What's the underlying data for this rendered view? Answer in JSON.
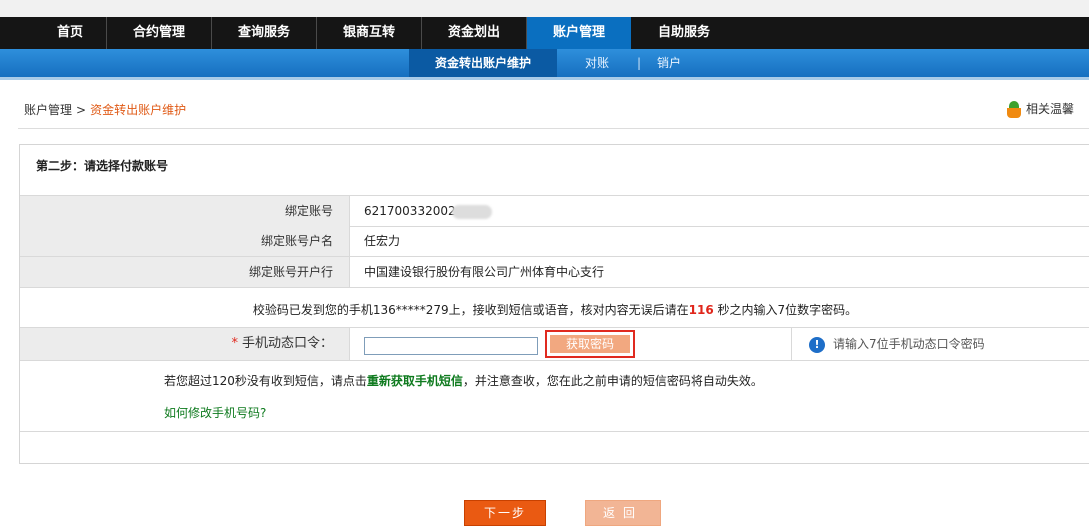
{
  "nav": {
    "items": [
      "首页",
      "合约管理",
      "查询服务",
      "银商互转",
      "资金划出",
      "账户管理",
      "自助服务"
    ],
    "active": "账户管理"
  },
  "subnav": {
    "items": [
      "资金转出账户维护",
      "对账",
      "销户"
    ],
    "separator": "|"
  },
  "breadcrumb": {
    "root": "账户管理",
    "arrow": ">",
    "current": "资金转出账户维护"
  },
  "tips_label": "相关温馨",
  "step": {
    "title": "第二步：请选择付款账号",
    "fields": [
      {
        "label": "绑定账号",
        "value": "621700332002"
      },
      {
        "label": "绑定账号户名",
        "value": "任宏力"
      },
      {
        "label": "绑定账号开户行",
        "value": "中国建设银行股份有限公司广州体育中心支行"
      }
    ]
  },
  "notice": {
    "before": "校验码已发到您的手机136*****279上，接收到短信或语音，核对内容无误后请在",
    "seconds": "116",
    "after": " 秒之内输入7位数字密码。"
  },
  "otp": {
    "required_mark": "*",
    "label": "手机动态口令：",
    "value": "",
    "get_button": "获取密码",
    "hint": "请输入7位手机动态口令密码",
    "info_glyph": "!"
  },
  "message": {
    "before": "若您超过120秒没有收到短信，请点击",
    "link": "重新获取手机短信",
    "after": "，并注意查收，您在此之前申请的短信密码将自动失效。"
  },
  "how_to_change_phone": "如何修改手机号码?",
  "buttons": {
    "next": "下一步",
    "back": "返回"
  },
  "colors": {
    "nav_bg": "#151515",
    "nav_active": "#0a6fc0",
    "subnav_bg": "#1f80d0",
    "accent_orange": "#ea5a12",
    "link_green": "#0e7a1e",
    "alert_red": "#e0261b"
  }
}
